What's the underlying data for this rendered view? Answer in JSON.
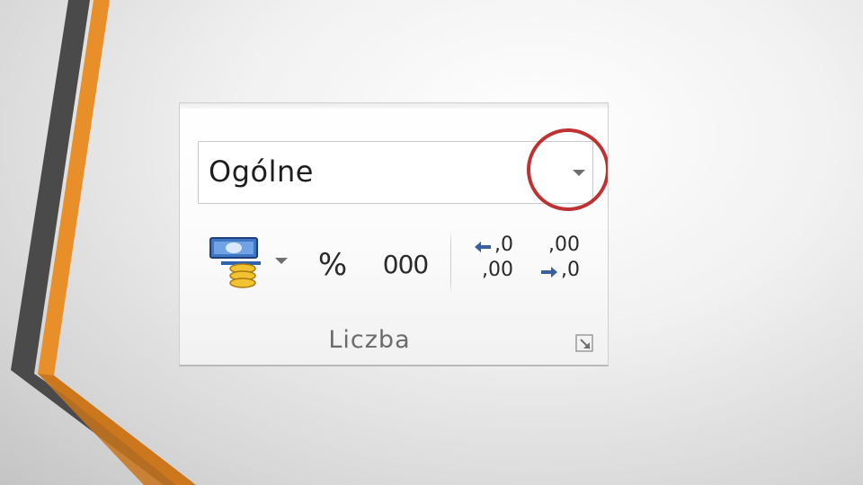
{
  "ribbon_group": {
    "number_format": {
      "value": "Ogólne",
      "dropdown_icon": "chevron-down-icon",
      "highlighted": true,
      "highlight_color": "#b71c1c"
    },
    "buttons": {
      "accounting_icon": "currency-coins-icon",
      "percent_label": "%",
      "thousands_label": "000",
      "increase_decimal": {
        "top": ",0",
        "bottom": ",00"
      },
      "decrease_decimal": {
        "top": ",00",
        "bottom": ",0"
      }
    },
    "group_label": "Liczba",
    "launcher_icon": "dialog-launcher-icon"
  },
  "colors": {
    "slide_accent_orange": "#e88f2a",
    "slide_accent_dark": "#4d4d4d",
    "arrow_blue": "#3a5f9c"
  }
}
